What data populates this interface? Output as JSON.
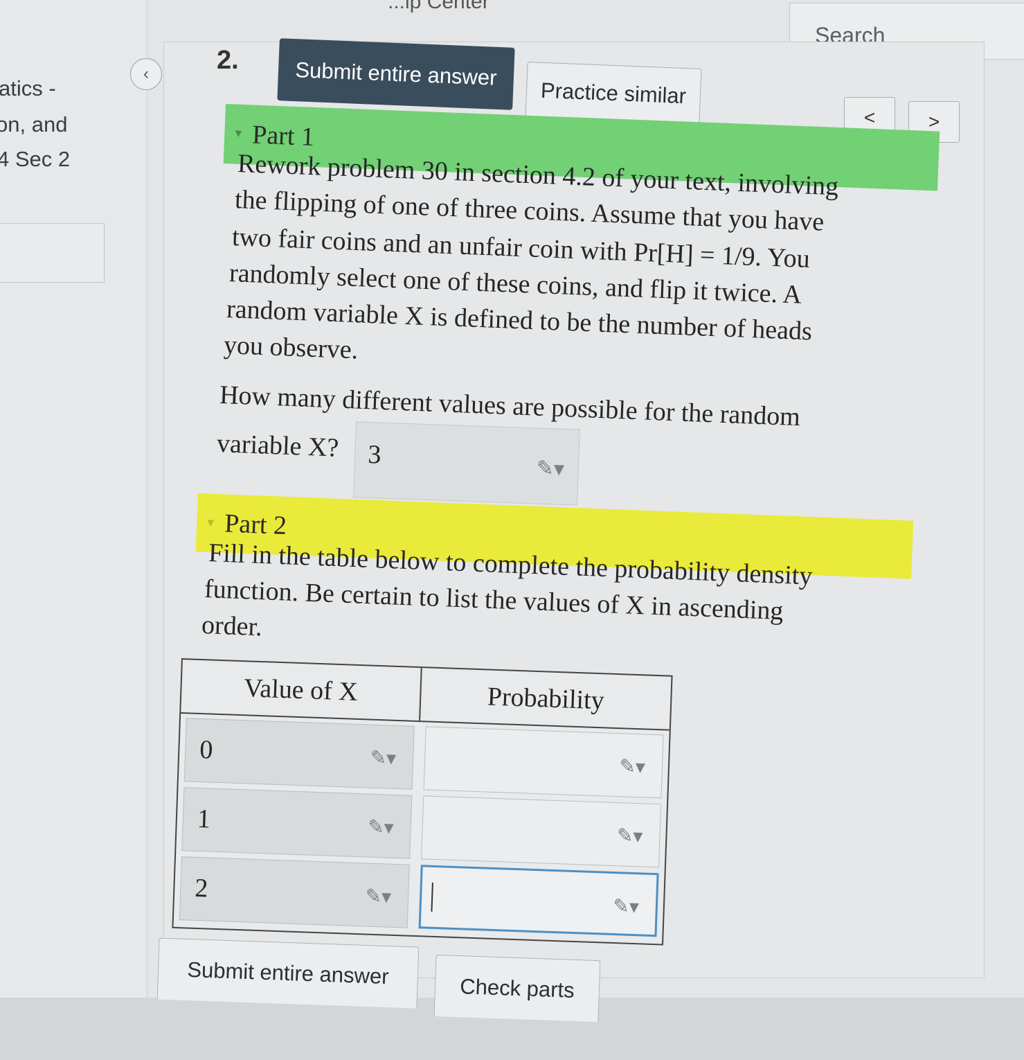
{
  "top_partial_title": "...ip Center",
  "search": {
    "label": "Search"
  },
  "sidebar": {
    "lines": [
      "atics -",
      "on, and",
      "4 Sec 2"
    ],
    "collapse_icon": "chevron-left-icon"
  },
  "question": {
    "number": "2.",
    "submit_label": "Submit entire answer",
    "practice_label": "Practice similar",
    "prev_label": "<",
    "next_label": ">"
  },
  "part1": {
    "title": "Part 1",
    "lines": [
      "Rework problem 30 in section 4.2 of your text, involving",
      "the flipping of one of three coins. Assume that you have",
      "two fair coins and an unfair coin with Pr[H] = 1/9. You",
      "randomly select one of these coins, and flip it twice. A",
      "random variable X is defined to be the number of heads",
      "you observe."
    ],
    "question_lines": [
      "How many different values are possible for the random",
      "variable X?"
    ],
    "answer": "3"
  },
  "part2": {
    "title": "Part 2",
    "lines": [
      "Fill in the table below to complete the probability density",
      "function. Be certain to list the values of X in ascending",
      "order."
    ],
    "table": {
      "headers": [
        "Value of X",
        "Probability"
      ],
      "rows": [
        {
          "x": "0",
          "p": ""
        },
        {
          "x": "1",
          "p": ""
        },
        {
          "x": "2",
          "p": ""
        }
      ]
    }
  },
  "footer": {
    "submit_label": "Submit entire answer",
    "check_label": "Check parts"
  },
  "colors": {
    "part1_bar": "#72d075",
    "part2_bar": "#eaea3a",
    "submit_button": "#3a4d5c",
    "focus_border": "#4a90c6"
  }
}
